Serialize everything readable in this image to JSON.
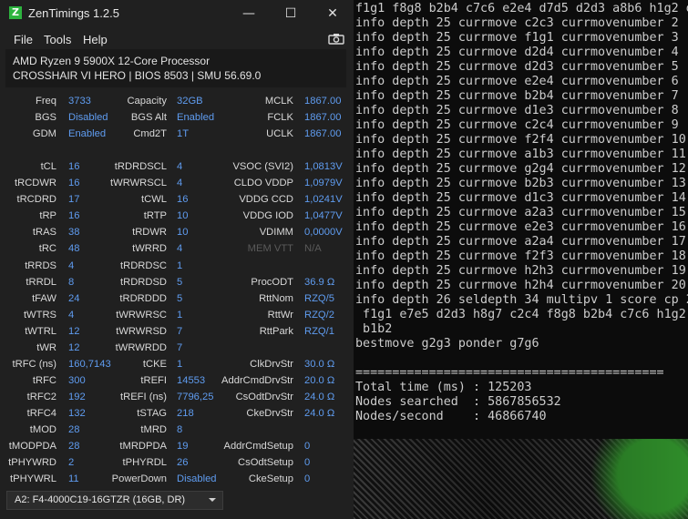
{
  "window": {
    "title": "ZenTimings 1.2.5",
    "icon_letter": "Z",
    "controls": {
      "minimize": "—",
      "maximize": "☐",
      "close": "✕"
    }
  },
  "menu": [
    "File",
    "Tools",
    "Help"
  ],
  "system": {
    "cpu": "AMD Ryzen 9 5900X 12-Core Processor",
    "board": "CROSSHAIR VI HERO | BIOS 8503 | SMU 56.69.0"
  },
  "timings": {
    "col1": [
      {
        "label": "Freq",
        "value": "3733"
      },
      {
        "label": "BGS",
        "value": "Disabled"
      },
      {
        "label": "GDM",
        "value": "Enabled"
      },
      null,
      {
        "label": "tCL",
        "value": "16"
      },
      {
        "label": "tRCDWR",
        "value": "16"
      },
      {
        "label": "tRCDRD",
        "value": "17"
      },
      {
        "label": "tRP",
        "value": "16"
      },
      {
        "label": "tRAS",
        "value": "38"
      },
      {
        "label": "tRC",
        "value": "48"
      },
      {
        "label": "tRRDS",
        "value": "4"
      },
      {
        "label": "tRRDL",
        "value": "8"
      },
      {
        "label": "tFAW",
        "value": "24"
      },
      {
        "label": "tWTRS",
        "value": "4"
      },
      {
        "label": "tWTRL",
        "value": "12"
      },
      {
        "label": "tWR",
        "value": "12"
      },
      {
        "label": "tRFC (ns)",
        "value": "160,7143"
      },
      {
        "label": "tRFC",
        "value": "300"
      },
      {
        "label": "tRFC2",
        "value": "192"
      },
      {
        "label": "tRFC4",
        "value": "132"
      },
      {
        "label": "tMOD",
        "value": "28"
      },
      {
        "label": "tMODPDA",
        "value": "28"
      },
      {
        "label": "tPHYWRD",
        "value": "2"
      },
      {
        "label": "tPHYWRL",
        "value": "11"
      }
    ],
    "col2": [
      {
        "label": "Capacity",
        "value": "32GB"
      },
      {
        "label": "BGS Alt",
        "value": "Enabled"
      },
      {
        "label": "Cmd2T",
        "value": "1T"
      },
      null,
      {
        "label": "tRDRDSCL",
        "value": "4"
      },
      {
        "label": "tWRWRSCL",
        "value": "4"
      },
      {
        "label": "tCWL",
        "value": "16"
      },
      {
        "label": "tRTP",
        "value": "10"
      },
      {
        "label": "tRDWR",
        "value": "10"
      },
      {
        "label": "tWRRD",
        "value": "4"
      },
      {
        "label": "tRDRDSC",
        "value": "1"
      },
      {
        "label": "tRDRDSD",
        "value": "5"
      },
      {
        "label": "tRDRDDD",
        "value": "5"
      },
      {
        "label": "tWRWRSC",
        "value": "1"
      },
      {
        "label": "tWRWRSD",
        "value": "7"
      },
      {
        "label": "tWRWRDD",
        "value": "7"
      },
      {
        "label": "tCKE",
        "value": "1"
      },
      {
        "label": "tREFI",
        "value": "14553"
      },
      {
        "label": "tREFI (ns)",
        "value": "7796,25"
      },
      {
        "label": "tSTAG",
        "value": "218"
      },
      {
        "label": "tMRD",
        "value": "8"
      },
      {
        "label": "tMRDPDA",
        "value": "19"
      },
      {
        "label": "tPHYRDL",
        "value": "26"
      },
      {
        "label": "PowerDown",
        "value": "Disabled"
      }
    ],
    "col3": [
      {
        "label": "MCLK",
        "value": "1867.00"
      },
      {
        "label": "FCLK",
        "value": "1867.00"
      },
      {
        "label": "UCLK",
        "value": "1867.00"
      },
      null,
      {
        "label": "VSOC (SVI2)",
        "value": "1,0813V"
      },
      {
        "label": "CLDO VDDP",
        "value": "1,0979V"
      },
      {
        "label": "VDDG CCD",
        "value": "1,0241V"
      },
      {
        "label": "VDDG IOD",
        "value": "1,0477V"
      },
      {
        "label": "VDIMM",
        "value": "0,0000V"
      },
      {
        "label": "MEM VTT",
        "value": "N/A",
        "dim": true
      },
      null,
      {
        "label": "ProcODT",
        "value": "36.9 Ω"
      },
      {
        "label": "RttNom",
        "value": "RZQ/5"
      },
      {
        "label": "RttWr",
        "value": "RZQ/2"
      },
      {
        "label": "RttPark",
        "value": "RZQ/1"
      },
      null,
      {
        "label": "ClkDrvStr",
        "value": "30.0 Ω"
      },
      {
        "label": "AddrCmdDrvStr",
        "value": "20.0 Ω"
      },
      {
        "label": "CsOdtDrvStr",
        "value": "24.0 Ω"
      },
      {
        "label": "CkeDrvStr",
        "value": "24.0 Ω"
      },
      null,
      {
        "label": "AddrCmdSetup",
        "value": "0"
      },
      {
        "label": "CsOdtSetup",
        "value": "0"
      },
      {
        "label": "CkeSetup",
        "value": "0"
      }
    ]
  },
  "footer": {
    "module": "A2: F4-4000C19-16GTZR (16GB, DR)"
  },
  "console": [
    "f1g1 f8g8 b2b4 c7c6 e2e4 d7d5 d2d3 a8b6 h1g2 d",
    "info depth 25 currmove c2c3 currmovenumber 2",
    "info depth 25 currmove f1g1 currmovenumber 3",
    "info depth 25 currmove d2d4 currmovenumber 4",
    "info depth 25 currmove d2d3 currmovenumber 5",
    "info depth 25 currmove e2e4 currmovenumber 6",
    "info depth 25 currmove b2b4 currmovenumber 7",
    "info depth 25 currmove d1e3 currmovenumber 8",
    "info depth 25 currmove c2c4 currmovenumber 9",
    "info depth 25 currmove f2f4 currmovenumber 10",
    "info depth 25 currmove a1b3 currmovenumber 11",
    "info depth 25 currmove g2g4 currmovenumber 12",
    "info depth 25 currmove b2b3 currmovenumber 13",
    "info depth 25 currmove d1c3 currmovenumber 14",
    "info depth 25 currmove a2a3 currmovenumber 15",
    "info depth 25 currmove e2e3 currmovenumber 16",
    "info depth 25 currmove a2a4 currmovenumber 17",
    "info depth 25 currmove f2f3 currmovenumber 18",
    "info depth 25 currmove h2h3 currmovenumber 19",
    "info depth 25 currmove h2h4 currmovenumber 20",
    "info depth 26 seldepth 34 multipv 1 score cp 2",
    " f1g1 e7e5 d2d3 h8g7 c2c4 f8g8 b2b4 c7c6 h1g2",
    " b1b2",
    "bestmove g2g3 ponder g7g6",
    "",
    "==========================================",
    "Total time (ms) : 125203",
    "Nodes searched  : 5867856532",
    "Nodes/second    : 46866740"
  ]
}
